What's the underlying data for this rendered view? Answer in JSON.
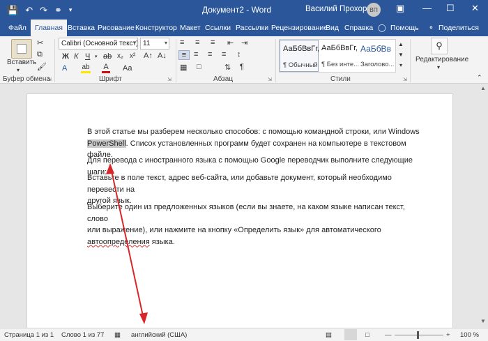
{
  "window": {
    "title": "Документ2 - Word",
    "user_name": "Василий Прохоров",
    "user_initials": "ВП"
  },
  "quick_access": [
    "save-icon",
    "undo-icon",
    "redo-icon",
    "autosave-icon",
    "more-icon"
  ],
  "tabs": [
    {
      "label": "Файл"
    },
    {
      "label": "Главная"
    },
    {
      "label": "Вставка"
    },
    {
      "label": "Рисование"
    },
    {
      "label": "Конструктор"
    },
    {
      "label": "Макет"
    },
    {
      "label": "Ссылки"
    },
    {
      "label": "Рассылки"
    },
    {
      "label": "Рецензирование"
    },
    {
      "label": "Вид"
    },
    {
      "label": "Справка"
    },
    {
      "label": "Помощь"
    },
    {
      "label": "Поделиться"
    }
  ],
  "active_tab": "Главная",
  "ribbon": {
    "paste_label": "Вставить",
    "groups": {
      "clipboard": "Буфер обмена",
      "font": "Шрифт",
      "paragraph": "Абзац",
      "styles": "Стили",
      "editing": "Редактирование"
    },
    "font_name": "Calibri (Основной текст)",
    "font_size": "11",
    "styles": [
      {
        "sample": "АаБбВвГг,",
        "name": "¶ Обычный"
      },
      {
        "sample": "АаБбВвГг,",
        "name": "¶ Без инте..."
      },
      {
        "sample": "АаБбВв",
        "name": "Заголово..."
      }
    ],
    "colors": {
      "highlight": "#ffe600",
      "font_color": "#d01010",
      "accent": "#2b579a"
    }
  },
  "document": {
    "p1_line1": "В этой статье мы разберем несколько способов: с помощью командной строки, или Windows",
    "p1_highlight": "PowerShell",
    "p1_rest": ". Список установленных программ будет сохранен на компьютере в текстовом файле.",
    "p2": "Для перевода с иностранного языка с помощью Google переводчик выполните следующие шаги:",
    "p3_line1": "Вставьте в поле текст, адрес веб-сайта, или добавьте документ, который необходимо перевести на",
    "p3_line2": "другой язык.",
    "p4_line1": "Выберите один из предложенных языков (если вы знаете, на каком языке написан текст, слово",
    "p4_line2": "или выражение), или нажмите на кнопку «Определить язык» для автоматического",
    "p4_squiggle": "автоопределения",
    "p4_end": " языка."
  },
  "status": {
    "page": "Страница 1 из 1",
    "words": "Слово 1 из 77",
    "language": "английский (США)",
    "zoom": "100 %"
  }
}
